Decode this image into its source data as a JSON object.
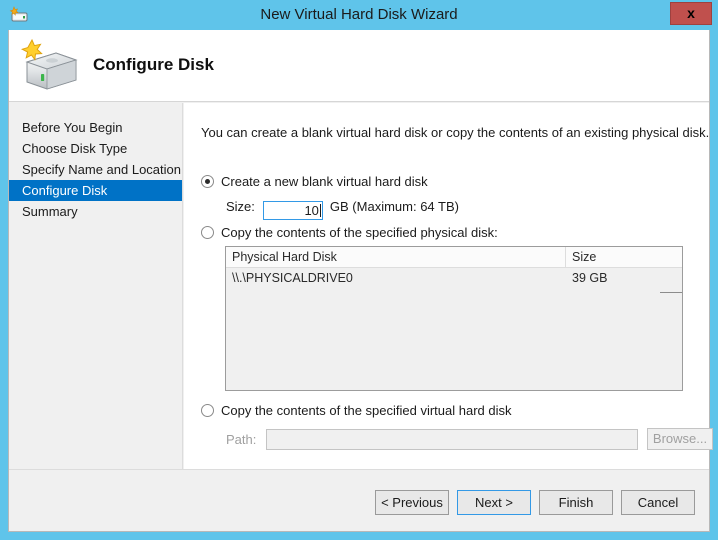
{
  "window": {
    "title": "New Virtual Hard Disk Wizard",
    "title_icon": "hard-disk-new-icon",
    "close_label": "x",
    "accent_color": "#5fc4ea",
    "close_color": "#c0504d"
  },
  "header": {
    "title": "Configure Disk",
    "icon": "hard-disk-wizard-icon"
  },
  "sidebar": {
    "items": [
      {
        "label": "Before You Begin",
        "selected": false
      },
      {
        "label": "Choose Disk Type",
        "selected": false
      },
      {
        "label": "Specify Name and Location",
        "selected": false
      },
      {
        "label": "Configure Disk",
        "selected": true
      },
      {
        "label": "Summary",
        "selected": false
      }
    ],
    "selected_bg": "#0072c6"
  },
  "main": {
    "intro": "You can create a blank virtual hard disk or copy the contents of an existing physical disk.",
    "option_blank": {
      "label": "Create a new blank virtual hard disk",
      "selected": true
    },
    "size": {
      "label": "Size:",
      "value": "10",
      "suffix": "GB (Maximum: 64 TB)"
    },
    "option_physical": {
      "label": "Copy the contents of the specified physical disk:",
      "selected": false
    },
    "disk_list": {
      "columns": [
        "Physical Hard Disk",
        "Size"
      ],
      "rows": [
        {
          "disk": "\\\\.\\PHYSICALDRIVE0",
          "size": "39 GB"
        }
      ]
    },
    "option_virtual": {
      "label": "Copy the contents of the specified virtual hard disk",
      "selected": false
    },
    "path": {
      "label": "Path:",
      "value": "",
      "browse_label": "Browse..."
    }
  },
  "footer": {
    "previous_label": "< Previous",
    "next_label": "Next >",
    "finish_label": "Finish",
    "cancel_label": "Cancel"
  }
}
